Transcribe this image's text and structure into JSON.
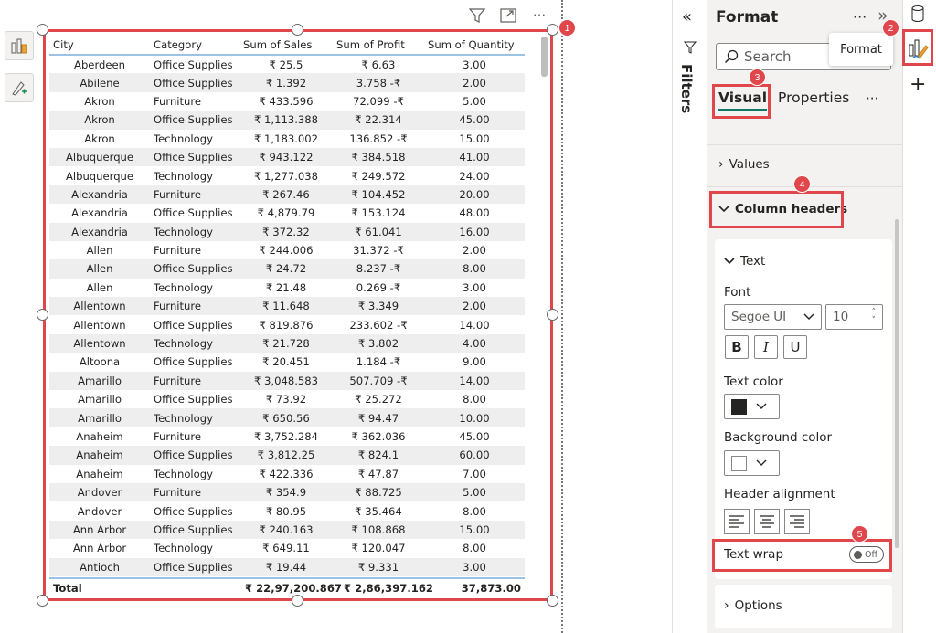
{
  "visual_table": {
    "columns": [
      "City",
      "Category",
      "Sum of Sales",
      "Sum of Profit",
      "Sum of Quantity"
    ],
    "rows": [
      [
        "Aberdeen",
        "Office Supplies",
        "₹ 25.5",
        "₹ 6.63",
        "3.00"
      ],
      [
        "Abilene",
        "Office Supplies",
        "₹ 1.392",
        "3.758 -₹",
        "2.00"
      ],
      [
        "Akron",
        "Furniture",
        "₹ 433.596",
        "72.099 -₹",
        "5.00"
      ],
      [
        "Akron",
        "Office Supplies",
        "₹ 1,113.388",
        "₹ 22.314",
        "45.00"
      ],
      [
        "Akron",
        "Technology",
        "₹ 1,183.002",
        "136.852 -₹",
        "15.00"
      ],
      [
        "Albuquerque",
        "Office Supplies",
        "₹ 943.122",
        "₹ 384.518",
        "41.00"
      ],
      [
        "Albuquerque",
        "Technology",
        "₹ 1,277.038",
        "₹ 249.572",
        "24.00"
      ],
      [
        "Alexandria",
        "Furniture",
        "₹ 267.46",
        "₹ 104.452",
        "20.00"
      ],
      [
        "Alexandria",
        "Office Supplies",
        "₹ 4,879.79",
        "₹ 153.124",
        "48.00"
      ],
      [
        "Alexandria",
        "Technology",
        "₹ 372.32",
        "₹ 61.041",
        "16.00"
      ],
      [
        "Allen",
        "Furniture",
        "₹ 244.006",
        "31.372 -₹",
        "2.00"
      ],
      [
        "Allen",
        "Office Supplies",
        "₹ 24.72",
        "8.237 -₹",
        "8.00"
      ],
      [
        "Allen",
        "Technology",
        "₹ 21.48",
        "0.269 -₹",
        "3.00"
      ],
      [
        "Allentown",
        "Furniture",
        "₹ 11.648",
        "₹ 3.349",
        "2.00"
      ],
      [
        "Allentown",
        "Office Supplies",
        "₹ 819.876",
        "233.602 -₹",
        "14.00"
      ],
      [
        "Allentown",
        "Technology",
        "₹ 21.728",
        "₹ 3.802",
        "4.00"
      ],
      [
        "Altoona",
        "Office Supplies",
        "₹ 20.451",
        "1.184 -₹",
        "9.00"
      ],
      [
        "Amarillo",
        "Furniture",
        "₹ 3,048.583",
        "507.709 -₹",
        "14.00"
      ],
      [
        "Amarillo",
        "Office Supplies",
        "₹ 73.92",
        "₹ 25.272",
        "8.00"
      ],
      [
        "Amarillo",
        "Technology",
        "₹ 650.56",
        "₹ 94.47",
        "10.00"
      ],
      [
        "Anaheim",
        "Furniture",
        "₹ 3,752.284",
        "₹ 362.036",
        "45.00"
      ],
      [
        "Anaheim",
        "Office Supplies",
        "₹ 3,812.25",
        "₹ 824.1",
        "60.00"
      ],
      [
        "Anaheim",
        "Technology",
        "₹ 422.336",
        "₹ 47.87",
        "7.00"
      ],
      [
        "Andover",
        "Furniture",
        "₹ 354.9",
        "₹ 88.725",
        "5.00"
      ],
      [
        "Andover",
        "Office Supplies",
        "₹ 80.95",
        "₹ 35.464",
        "8.00"
      ],
      [
        "Ann Arbor",
        "Office Supplies",
        "₹ 240.163",
        "₹ 108.868",
        "15.00"
      ],
      [
        "Ann Arbor",
        "Technology",
        "₹ 649.11",
        "₹ 120.047",
        "8.00"
      ],
      [
        "Antioch",
        "Office Supplies",
        "₹ 19.44",
        "₹ 9.331",
        "3.00"
      ]
    ],
    "total": {
      "label": "Total",
      "sales": "₹ 22,97,200.867",
      "profit": "₹ 2,86,397.162",
      "quantity": "37,873.00"
    }
  },
  "filters_pane": {
    "label": "Filters"
  },
  "format_pane": {
    "title": "Format",
    "more": "···",
    "expand": "»",
    "search_placeholder": "Search",
    "tooltip": "Format",
    "tabs": {
      "visual": "Visual",
      "properties": "Properties",
      "more": "···"
    },
    "sections": {
      "values": "Values",
      "column_headers": "Column headers",
      "text": "Text",
      "options": "Options"
    },
    "font_label": "Font",
    "font_family": "Segoe UI",
    "font_size": "10",
    "bold": "B",
    "italic": "I",
    "underline": "U",
    "text_color_label": "Text color",
    "background_color_label": "Background color",
    "header_alignment_label": "Header alignment",
    "text_wrap_label": "Text wrap",
    "text_wrap_state": "Off"
  },
  "badges": [
    "1",
    "2",
    "3",
    "4",
    "5"
  ],
  "colors": {
    "highlight": "#e0474c",
    "text_color_swatch": "#252423",
    "background_color_swatch": "#ffffff",
    "accent": "#117865"
  }
}
